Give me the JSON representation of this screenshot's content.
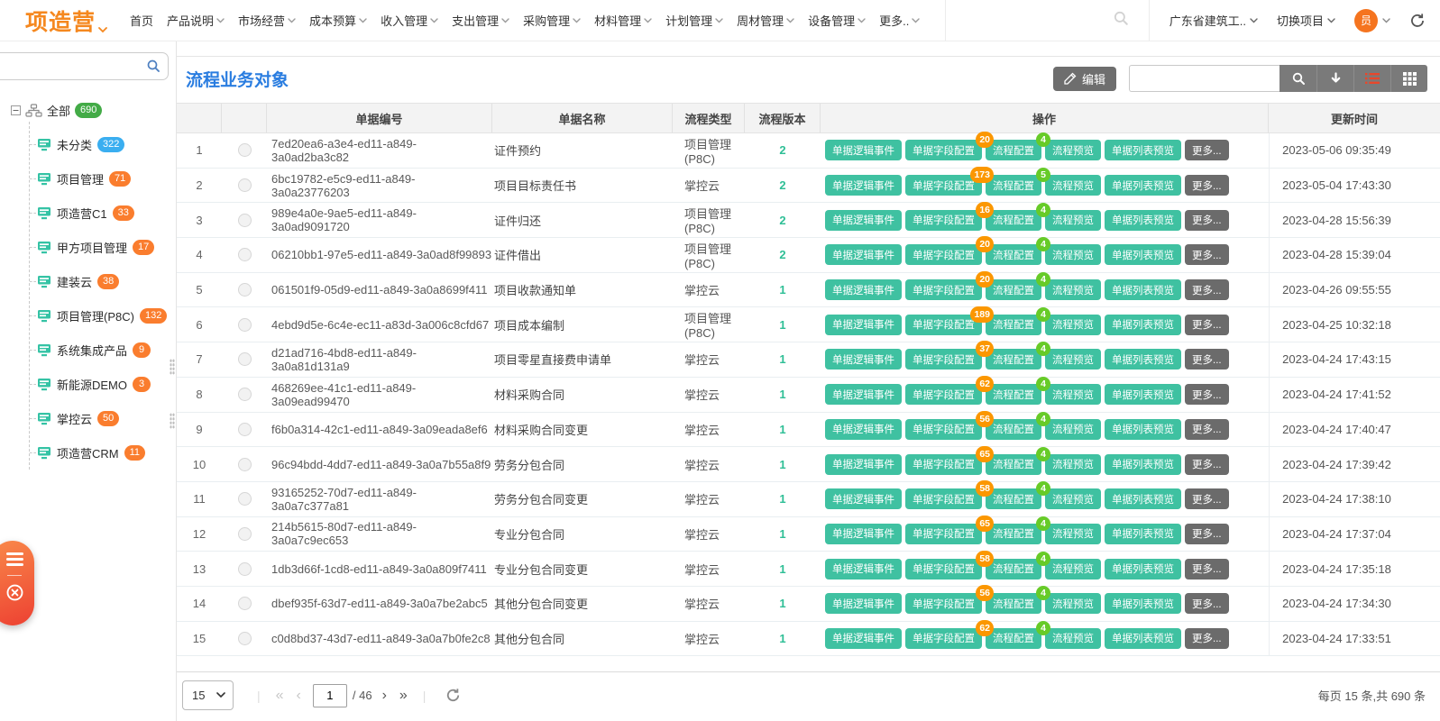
{
  "nav": {
    "logo": "项造营",
    "menu": [
      {
        "label": "首页",
        "chevron": false
      },
      {
        "label": "产品说明",
        "chevron": true
      },
      {
        "label": "市场经营",
        "chevron": true
      },
      {
        "label": "成本预算",
        "chevron": true
      },
      {
        "label": "收入管理",
        "chevron": true
      },
      {
        "label": "支出管理",
        "chevron": true
      },
      {
        "label": "采购管理",
        "chevron": true
      },
      {
        "label": "材料管理",
        "chevron": true
      },
      {
        "label": "计划管理",
        "chevron": true
      },
      {
        "label": "周材管理",
        "chevron": true
      },
      {
        "label": "设备管理",
        "chevron": true
      },
      {
        "label": "更多..",
        "chevron": true
      }
    ],
    "project": "广东省建筑工..",
    "switch_project": "切换项目",
    "avatar": "员"
  },
  "sidebar": {
    "root": {
      "label": "全部",
      "count": "690",
      "badge_color": "#43ab47"
    },
    "items": [
      {
        "label": "未分类",
        "count": "322",
        "badge_color": "#3aaef0"
      },
      {
        "label": "项目管理",
        "count": "71",
        "badge_color": "#fa7d2e"
      },
      {
        "label": "项造营C1",
        "count": "33",
        "badge_color": "#fa7d2e"
      },
      {
        "label": "甲方项目管理",
        "count": "17",
        "badge_color": "#fa7d2e"
      },
      {
        "label": "建装云",
        "count": "38",
        "badge_color": "#fa7d2e"
      },
      {
        "label": "项目管理(P8C)",
        "count": "132",
        "badge_color": "#fa7d2e"
      },
      {
        "label": "系统集成产品",
        "count": "9",
        "badge_color": "#fa7d2e"
      },
      {
        "label": "新能源DEMO",
        "count": "3",
        "badge_color": "#fa7d2e"
      },
      {
        "label": "掌控云",
        "count": "50",
        "badge_color": "#fa7d2e"
      },
      {
        "label": "项造营CRM",
        "count": "11",
        "badge_color": "#fa7d2e"
      }
    ]
  },
  "main": {
    "title": "流程业务对象",
    "toolbar": {
      "edit": "编辑"
    },
    "table": {
      "headers": {
        "code": "单据编号",
        "name": "单据名称",
        "type": "流程类型",
        "version": "流程版本",
        "actions": "操作",
        "updated": "更新时间"
      },
      "actions": {
        "logic": "单据逻辑事件",
        "field": "单据字段配置",
        "flow": "流程配置",
        "preview": "流程预览",
        "list": "单据列表预览",
        "more": "更多..."
      },
      "rows": [
        {
          "num": "1",
          "code": "7ed20ea6-a3e4-ed11-a849-3a0ad2ba3c82",
          "name": "证件预约",
          "type": "项目管理(P8C)",
          "version": "2",
          "field_badge": "20",
          "flow_badge": "4",
          "updated": "2023-05-06 09:35:49"
        },
        {
          "num": "2",
          "code": "6bc19782-e5c9-ed11-a849-3a0a23776203",
          "name": "项目目标责任书",
          "type": "掌控云",
          "version": "2",
          "field_badge": "173",
          "flow_badge": "5",
          "updated": "2023-05-04 17:43:30"
        },
        {
          "num": "3",
          "code": "989e4a0e-9ae5-ed11-a849-3a0ad9091720",
          "name": "证件归还",
          "type": "项目管理(P8C)",
          "version": "2",
          "field_badge": "16",
          "flow_badge": "4",
          "updated": "2023-04-28 15:56:39"
        },
        {
          "num": "4",
          "code": "06210bb1-97e5-ed11-a849-3a0ad8f99893",
          "name": "证件借出",
          "type": "项目管理(P8C)",
          "version": "2",
          "field_badge": "20",
          "flow_badge": "4",
          "updated": "2023-04-28 15:39:04"
        },
        {
          "num": "5",
          "code": "061501f9-05d9-ed11-a849-3a0a8699f411",
          "name": "项目收款通知单",
          "type": "掌控云",
          "version": "1",
          "field_badge": "20",
          "flow_badge": "4",
          "updated": "2023-04-26 09:55:55"
        },
        {
          "num": "6",
          "code": "4ebd9d5e-6c4e-ec11-a83d-3a006c8cfd67",
          "name": "项目成本编制",
          "type": "项目管理(P8C)",
          "version": "1",
          "field_badge": "189",
          "flow_badge": "4",
          "updated": "2023-04-25 10:32:18"
        },
        {
          "num": "7",
          "code": "d21ad716-4bd8-ed11-a849-3a0a81d131a9",
          "name": "项目零星直接费申请单",
          "type": "掌控云",
          "version": "1",
          "field_badge": "37",
          "flow_badge": "4",
          "updated": "2023-04-24 17:43:15"
        },
        {
          "num": "8",
          "code": "468269ee-41c1-ed11-a849-3a09ead99470",
          "name": "材料采购合同",
          "type": "掌控云",
          "version": "1",
          "field_badge": "62",
          "flow_badge": "4",
          "updated": "2023-04-24 17:41:52"
        },
        {
          "num": "9",
          "code": "f6b0a314-42c1-ed11-a849-3a09eada8ef6",
          "name": "材料采购合同变更",
          "type": "掌控云",
          "version": "1",
          "field_badge": "56",
          "flow_badge": "4",
          "updated": "2023-04-24 17:40:47"
        },
        {
          "num": "10",
          "code": "96c94bdd-4dd7-ed11-a849-3a0a7b55a8f9",
          "name": "劳务分包合同",
          "type": "掌控云",
          "version": "1",
          "field_badge": "65",
          "flow_badge": "4",
          "updated": "2023-04-24 17:39:42"
        },
        {
          "num": "11",
          "code": "93165252-70d7-ed11-a849-3a0a7c377a81",
          "name": "劳务分包合同变更",
          "type": "掌控云",
          "version": "1",
          "field_badge": "58",
          "flow_badge": "4",
          "updated": "2023-04-24 17:38:10"
        },
        {
          "num": "12",
          "code": "214b5615-80d7-ed11-a849-3a0a7c9ec653",
          "name": "专业分包合同",
          "type": "掌控云",
          "version": "1",
          "field_badge": "65",
          "flow_badge": "4",
          "updated": "2023-04-24 17:37:04"
        },
        {
          "num": "13",
          "code": "1db3d66f-1cd8-ed11-a849-3a0a809f7411",
          "name": "专业分包合同变更",
          "type": "掌控云",
          "version": "1",
          "field_badge": "58",
          "flow_badge": "4",
          "updated": "2023-04-24 17:35:18"
        },
        {
          "num": "14",
          "code": "dbef935f-63d7-ed11-a849-3a0a7be2abc5",
          "name": "其他分包合同变更",
          "type": "掌控云",
          "version": "1",
          "field_badge": "56",
          "flow_badge": "4",
          "updated": "2023-04-24 17:34:30"
        },
        {
          "num": "15",
          "code": "c0d8bd37-43d7-ed11-a849-3a0a7b0fe2c8",
          "name": "其他分包合同",
          "type": "掌控云",
          "version": "1",
          "field_badge": "62",
          "flow_badge": "4",
          "updated": "2023-04-24 17:33:51"
        }
      ]
    },
    "pagination": {
      "page_size": "15",
      "current_page": "1",
      "total_label": "/ 46",
      "summary": "每页 15 条,共 690 条"
    }
  },
  "colors": {
    "brand_orange": "#f5881f",
    "title_blue": "#2a7de0",
    "action_teal": "#3fc1a1",
    "badge_orange": "#fb9700",
    "badge_green": "#67cb28",
    "badge_blue": "#3aaef0",
    "badge_root_green": "#43ab47",
    "sidebar_badge_orange": "#fa7d2e",
    "active_view_icon": "#e8472b"
  }
}
